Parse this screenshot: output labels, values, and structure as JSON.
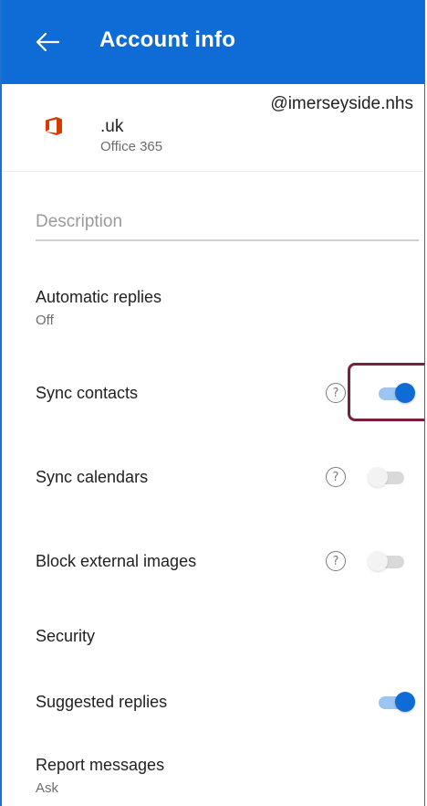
{
  "appbar": {
    "title": "Account info",
    "back_icon": "arrow-left-icon"
  },
  "account": {
    "icon": "office-365-icon",
    "email_domain": "@imerseyside.nhs",
    "email_suffix": ".uk",
    "type": "Office 365"
  },
  "description": {
    "placeholder": "Description",
    "value": ""
  },
  "settings": {
    "automatic_replies": {
      "label": "Automatic replies",
      "value": "Off"
    },
    "sync_contacts": {
      "label": "Sync contacts",
      "enabled": true
    },
    "sync_calendars": {
      "label": "Sync calendars",
      "enabled": false
    },
    "block_external_images": {
      "label": "Block external images",
      "enabled": false
    },
    "security": {
      "label": "Security"
    },
    "suggested_replies": {
      "label": "Suggested replies",
      "enabled": true
    },
    "report_messages": {
      "label": "Report messages",
      "value": "Ask"
    }
  },
  "help_glyph": "?",
  "colors": {
    "accent": "#0f6cd6",
    "highlight": "#7b1e3b"
  }
}
